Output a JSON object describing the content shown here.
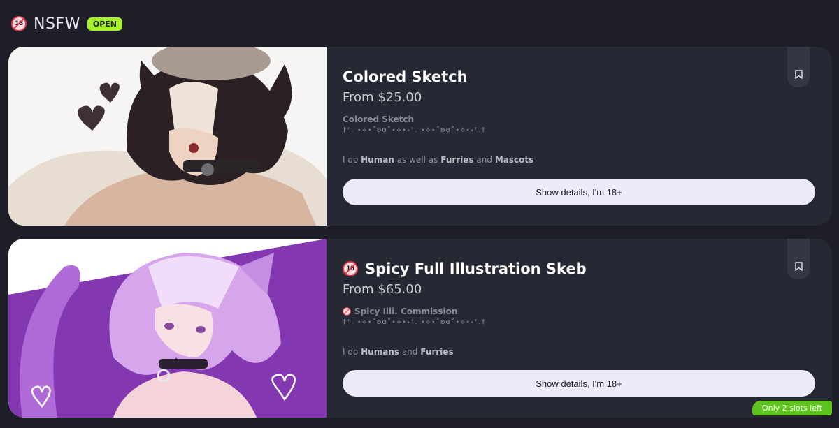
{
  "section": {
    "icon_text": "18",
    "title": "NSFW",
    "status_badge": "OPEN"
  },
  "cards": [
    {
      "title": "Colored Sketch",
      "price": "From $25.00",
      "desc_title": "Colored Sketch",
      "deco": "†⁺. ⋆⟡⋆˚ʚɞ˚⋆⟡⋆˖⁺. ⋆⟡⋆˚ʚɞ˚⋆⟡⋆˖⁺.†",
      "tag_prefix": "I do ",
      "tag_1": "Human",
      "tag_mid": " as well as ",
      "tag_2": "Furries",
      "tag_and": " and ",
      "tag_3": "Mascots",
      "button_label": "Show details, I'm 18+",
      "has_age_icon": false
    },
    {
      "title": "Spicy Full Illustration Skeb",
      "price": "From $65.00",
      "desc_title": "Spicy Illi. Commission",
      "deco": "†⁺. ⋆⟡⋆˚ʚɞ˚⋆⟡⋆˖⁺. ⋆⟡⋆˚ʚɞ˚⋆⟡⋆˖⁺.†",
      "tag_prefix": "I do ",
      "tag_1": "Humans",
      "tag_and": " and ",
      "tag_2": "Furries",
      "button_label": "Show details, I'm 18+",
      "has_age_icon": true,
      "slots_badge": "Only 2 slots left"
    }
  ],
  "icons": {
    "age": "no-under-18-icon",
    "bookmark": "bookmark-icon"
  },
  "colors": {
    "background": "#1d1e27",
    "card": "#262834",
    "open_badge": "#a6f02c",
    "slots_badge": "#5fc31f",
    "button": "#eceaf8"
  }
}
